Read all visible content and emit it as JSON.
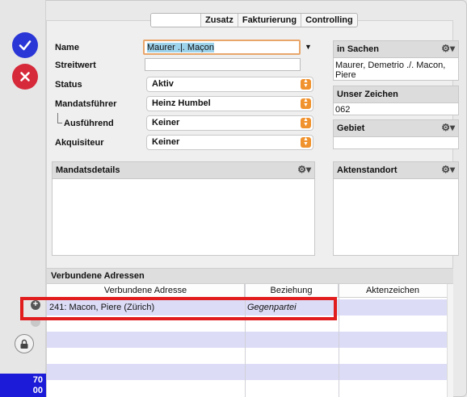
{
  "tabs": [
    "",
    "Zusatz",
    "Fakturierung",
    "Controlling"
  ],
  "form": {
    "name_label": "Name",
    "name_value": "Maurer .|. Maçon",
    "streitwert_label": "Streitwert",
    "streitwert_value": "",
    "status_label": "Status",
    "status_value": "Aktiv",
    "mandatsfuehrer_label": "Mandatsführer",
    "mandatsfuehrer_value": "Heinz Humbel",
    "ausfuehrend_label": "Ausführend",
    "ausfuehrend_value": "Keiner",
    "akquisiteur_label": "Akquisiteur",
    "akquisiteur_value": "Keiner"
  },
  "side": {
    "in_sachen_label": "in Sachen",
    "in_sachen_value": "Maurer, Demetrio ./. Macon, Piere",
    "unser_zeichen_label": "Unser Zeichen",
    "unser_zeichen_value": "062",
    "gebiet_label": "Gebiet",
    "gebiet_value": ""
  },
  "boxes": {
    "mandatsdetails_label": "Mandatsdetails",
    "aktenstandort_label": "Aktenstandort"
  },
  "verbundene": {
    "section_title": "Verbundene Adressen",
    "columns": [
      "Verbundene Adresse",
      "Beziehung",
      "Aktenzeichen"
    ],
    "rows": [
      {
        "adresse": "241: Macon, Piere (Zürich)",
        "beziehung": "Gegenpartei",
        "aktenzeichen": ""
      }
    ]
  },
  "counter": {
    "line1": "70",
    "line2": "00"
  },
  "icons": {
    "ok": "checkmark-icon",
    "cancel": "x-icon",
    "lock": "lock-icon",
    "gear": "gear-icon",
    "popup": "updown-arrows-icon",
    "add": "plus-icon",
    "remove": "minus-icon"
  },
  "colors": {
    "ok": "#2b36d6",
    "cancel": "#d6293a",
    "popup_stepper": "#f0922e",
    "row_alt": "#dcdcf7",
    "highlight": "#e21d1d",
    "counter_bg": "#1c1cd8"
  }
}
